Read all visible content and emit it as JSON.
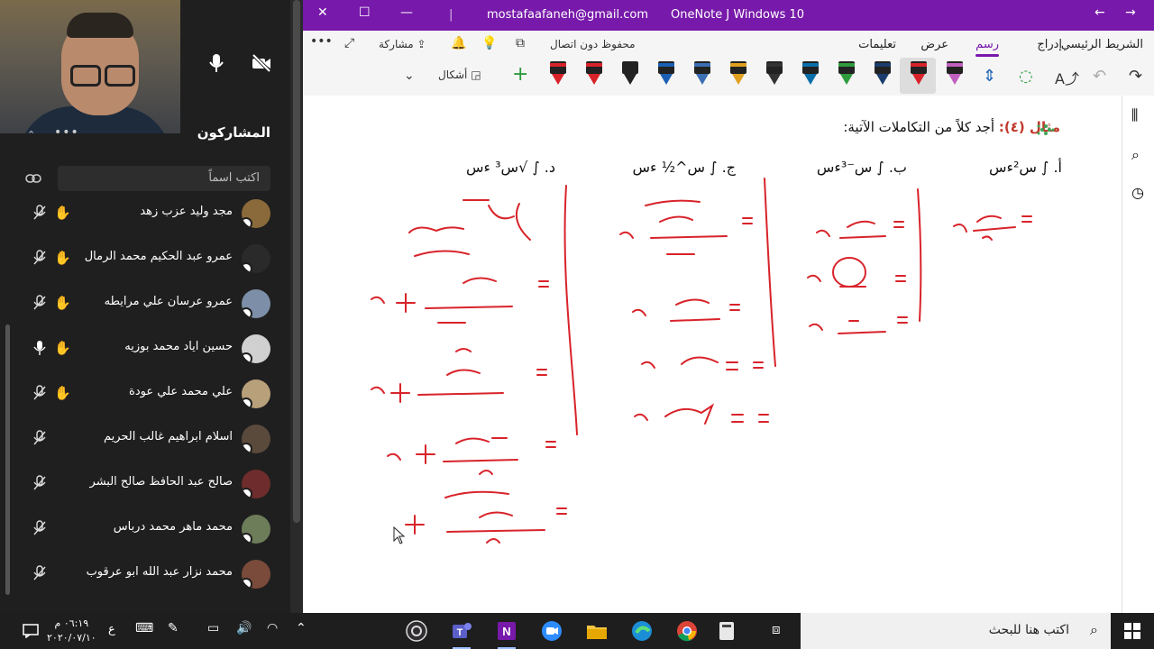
{
  "teams": {
    "participants_title": "المشاركون",
    "search_placeholder": "اكتب اسماً",
    "participants": [
      {
        "name": "مجد وليد عزب زهد",
        "hand": true,
        "mic": "muted",
        "avatar_color": "#8a6a3a"
      },
      {
        "name": "عمرو عبد الحكيم محمد الرمال",
        "hand": true,
        "mic": "muted",
        "avatar_color": "#2a2a2a"
      },
      {
        "name": "عمرو عرسان علي مرايطه",
        "hand": true,
        "mic": "muted",
        "avatar_color": "#7d8fa8"
      },
      {
        "name": "حسين اياد محمد بوزيه",
        "hand": true,
        "mic": "on",
        "avatar_color": "#d0d0d0"
      },
      {
        "name": "علي محمد علي عودة",
        "hand": true,
        "mic": "muted",
        "avatar_color": "#b8a07a"
      },
      {
        "name": "اسلام ابراهيم غالب الحريم",
        "hand": false,
        "mic": "muted",
        "avatar_color": "#5a4a3c"
      },
      {
        "name": "صالح عبد الحافظ صالح البشر",
        "hand": false,
        "mic": "muted",
        "avatar_color": "#6e2c2c"
      },
      {
        "name": "محمد ماهر محمد درباس",
        "hand": false,
        "mic": "muted",
        "avatar_color": "#6d7d5a"
      },
      {
        "name": "محمد نزار عبد الله ابو عرقوب",
        "hand": false,
        "mic": "muted",
        "avatar_color": "#7a4a3a"
      }
    ]
  },
  "onenote": {
    "account": "mostafaafaneh@gmail.com",
    "app_title": "OneNote J Windows 10",
    "tabs": [
      "الشريط الرئيسي",
      "إدراج",
      "رسم",
      "عرض",
      "تعليمات"
    ],
    "active_tab": "رسم",
    "saved_status": "محفوظ دون اتصال",
    "share_label": "مشاركة",
    "shapes_label": "أشكال",
    "accent": "#7719aa",
    "pen_colors": [
      "#d8232a",
      "#d8232a",
      "#222222",
      "#1a5fb4",
      "#3c6eb4",
      "#e0a020",
      "#333333",
      "#0a6ea8",
      "#2e9b3c",
      "#1a3d6e",
      "#d8232a",
      "#c060c0"
    ],
    "page": {
      "example_label": "مثال (٤):",
      "example_text": "أجد كلاً من التكاملات الآتية:",
      "items": [
        {
          "label": "أ.",
          "expr": "∫ س²ءس"
        },
        {
          "label": "ب.",
          "expr": "∫ س⁻³ءس"
        },
        {
          "label": "ج.",
          "expr": "∫ س^½ ءس"
        },
        {
          "label": "د.",
          "expr": "∫ √س³ ءس"
        }
      ]
    }
  },
  "taskbar": {
    "search_placeholder": "اكتب هنا للبحث",
    "time": "٠٦:١٩ م",
    "date": "٢٠٢٠/٠٧/١٠",
    "lang": "ع"
  }
}
